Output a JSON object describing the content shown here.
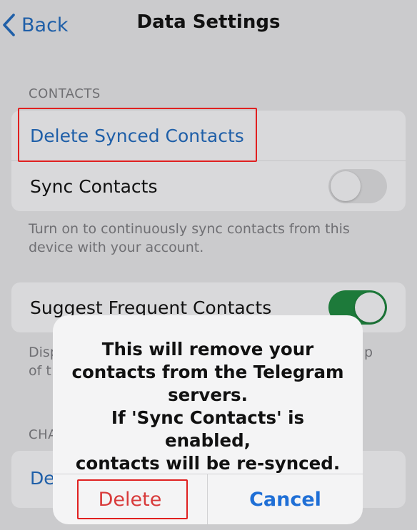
{
  "nav": {
    "back_label": "Back",
    "title": "Data Settings"
  },
  "contacts_section": {
    "header": "CONTACTS",
    "delete_synced_label": "Delete Synced Contacts",
    "sync_contacts_label": "Sync Contacts",
    "sync_contacts_on": false,
    "footer": "Turn on to continuously sync contacts from this device with your account."
  },
  "suggest_section": {
    "label": "Suggest Frequent Contacts",
    "enabled": true,
    "footer_visible_start": "Disp",
    "footer_visible_line2_start": "of t",
    "footer_visible_end": "p"
  },
  "chats_section": {
    "header_partial": "CHA",
    "row_partial": "De"
  },
  "alert": {
    "message_lines": [
      "This will remove your",
      "contacts from the Telegram",
      "servers.",
      "If 'Sync Contacts' is enabled,",
      "contacts will be re-synced."
    ],
    "delete_label": "Delete",
    "cancel_label": "Cancel"
  },
  "colors": {
    "accent_blue": "#1f5fa8",
    "destructive_red": "#d83a3a",
    "toggle_on_green": "#1d7a3a",
    "highlight_red": "#e02020"
  }
}
